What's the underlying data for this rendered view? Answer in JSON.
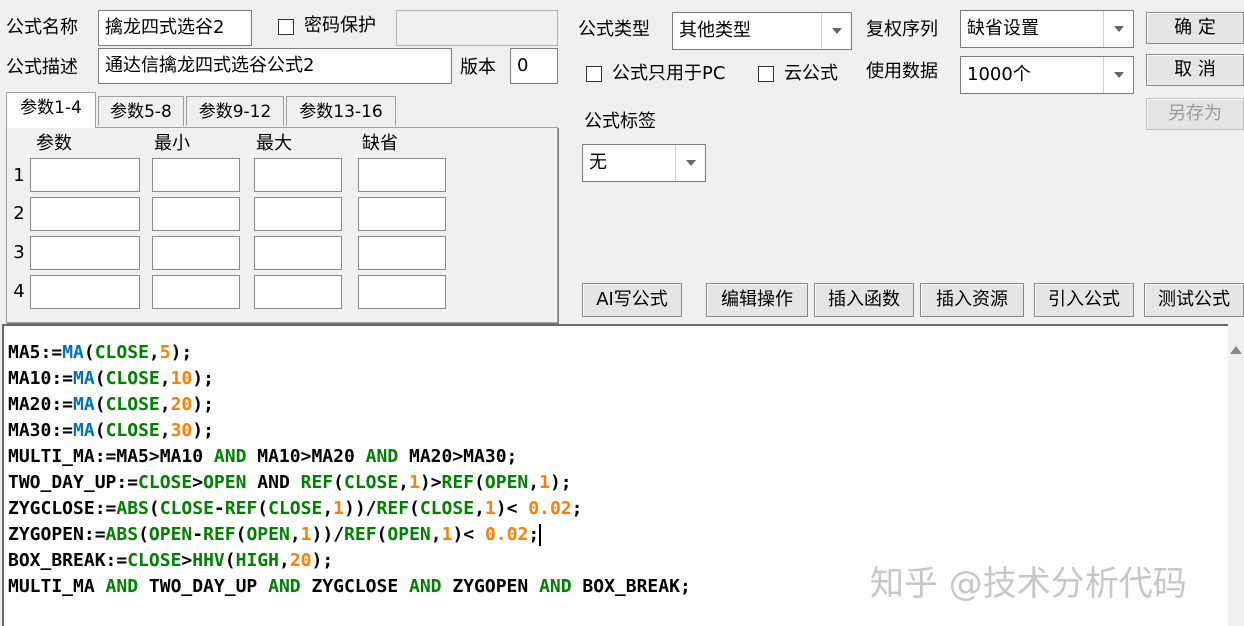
{
  "formula_name": {
    "label": "公式名称",
    "value": "擒龙四式选谷2"
  },
  "password": {
    "label": "密码保护",
    "value": ""
  },
  "formula_desc": {
    "label": "公式描述",
    "value": "通达信擒龙四式选谷公式2"
  },
  "version": {
    "label": "版本",
    "value": "0"
  },
  "formula_type": {
    "label": "公式类型",
    "value": "其他类型"
  },
  "rights_seq": {
    "label": "复权序列",
    "value": "缺省设置"
  },
  "pc_only": {
    "label": "公式只用于PC"
  },
  "cloud": {
    "label": "云公式"
  },
  "usage_data": {
    "label": "使用数据",
    "value": "1000个"
  },
  "formula_tag": {
    "label": "公式标签",
    "value": "无"
  },
  "buttons": {
    "ok": "确  定",
    "cancel": "取  消",
    "save_as": "另存为",
    "ai": "AI写公式",
    "edit": "编辑操作",
    "insert_func": "插入函数",
    "insert_res": "插入资源",
    "import": "引入公式",
    "test": "测试公式"
  },
  "tabs": [
    "参数1-4",
    "参数5-8",
    "参数9-12",
    "参数13-16"
  ],
  "param_headers": [
    "参数",
    "最小",
    "最大",
    "缺省"
  ],
  "param_rows": [
    "1",
    "2",
    "3",
    "4"
  ],
  "code_lines": [
    [
      [
        "k",
        "MA5:="
      ],
      [
        "fb",
        "MA"
      ],
      [
        "o",
        "("
      ],
      [
        "fg",
        "CLOSE"
      ],
      [
        "o",
        ","
      ],
      [
        "n",
        "5"
      ],
      [
        "o",
        ");"
      ]
    ],
    [
      [
        "k",
        "MA10:="
      ],
      [
        "fb",
        "MA"
      ],
      [
        "o",
        "("
      ],
      [
        "fg",
        "CLOSE"
      ],
      [
        "o",
        ","
      ],
      [
        "n",
        "10"
      ],
      [
        "o",
        ");"
      ]
    ],
    [
      [
        "k",
        "MA20:="
      ],
      [
        "fb",
        "MA"
      ],
      [
        "o",
        "("
      ],
      [
        "fg",
        "CLOSE"
      ],
      [
        "o",
        ","
      ],
      [
        "n",
        "20"
      ],
      [
        "o",
        ");"
      ]
    ],
    [
      [
        "k",
        "MA30:="
      ],
      [
        "fb",
        "MA"
      ],
      [
        "o",
        "("
      ],
      [
        "fg",
        "CLOSE"
      ],
      [
        "o",
        ","
      ],
      [
        "n",
        "30"
      ],
      [
        "o",
        ");"
      ]
    ],
    [
      [
        "k",
        "MULTI_MA:=MA5>MA10 "
      ],
      [
        "and",
        "AND"
      ],
      [
        "k",
        " MA10>MA20 "
      ],
      [
        "and",
        "AND"
      ],
      [
        "k",
        " MA20>MA30;"
      ]
    ],
    [
      [
        "k",
        "TWO_DAY_UP:="
      ],
      [
        "fg",
        "CLOSE"
      ],
      [
        "o",
        ">"
      ],
      [
        "fg",
        "OPEN"
      ],
      [
        "k",
        " AND "
      ],
      [
        "fg",
        "REF"
      ],
      [
        "o",
        "("
      ],
      [
        "fg",
        "CLOSE"
      ],
      [
        "o",
        ","
      ],
      [
        "n",
        "1"
      ],
      [
        "o",
        ")>"
      ],
      [
        "fg",
        "REF"
      ],
      [
        "o",
        "("
      ],
      [
        "fg",
        "OPEN"
      ],
      [
        "o",
        ","
      ],
      [
        "n",
        "1"
      ],
      [
        "o",
        ");"
      ]
    ],
    [
      [
        "k",
        "ZYGCLOSE:="
      ],
      [
        "fg",
        "ABS"
      ],
      [
        "o",
        "("
      ],
      [
        "fg",
        "CLOSE"
      ],
      [
        "o",
        "-"
      ],
      [
        "fg",
        "REF"
      ],
      [
        "o",
        "("
      ],
      [
        "fg",
        "CLOSE"
      ],
      [
        "o",
        ","
      ],
      [
        "n",
        "1"
      ],
      [
        "o",
        "))/"
      ],
      [
        "fg",
        "REF"
      ],
      [
        "o",
        "("
      ],
      [
        "fg",
        "CLOSE"
      ],
      [
        "o",
        ","
      ],
      [
        "n",
        "1"
      ],
      [
        "o",
        ")< "
      ],
      [
        "n",
        "0.02"
      ],
      [
        "o",
        ";"
      ]
    ],
    [
      [
        "k",
        "ZYGOPEN:="
      ],
      [
        "fg",
        "ABS"
      ],
      [
        "o",
        "("
      ],
      [
        "fg",
        "OPEN"
      ],
      [
        "o",
        "-"
      ],
      [
        "fg",
        "REF"
      ],
      [
        "o",
        "("
      ],
      [
        "fg",
        "OPEN"
      ],
      [
        "o",
        ","
      ],
      [
        "n",
        "1"
      ],
      [
        "o",
        "))/"
      ],
      [
        "fg",
        "REF"
      ],
      [
        "o",
        "("
      ],
      [
        "fg",
        "OPEN"
      ],
      [
        "o",
        ","
      ],
      [
        "n",
        "1"
      ],
      [
        "o",
        ")< "
      ],
      [
        "n",
        "0.02"
      ],
      [
        "o",
        ";"
      ],
      [
        "caret",
        ""
      ]
    ],
    [
      [
        "k",
        "BOX_BREAK:="
      ],
      [
        "fg",
        "CLOSE"
      ],
      [
        "o",
        ">"
      ],
      [
        "fg",
        "HHV"
      ],
      [
        "o",
        "("
      ],
      [
        "fg",
        "HIGH"
      ],
      [
        "o",
        ","
      ],
      [
        "n",
        "20"
      ],
      [
        "o",
        ");"
      ]
    ],
    [
      [
        "k",
        "MULTI_MA "
      ],
      [
        "and",
        "AND"
      ],
      [
        "k",
        " TWO_DAY_UP "
      ],
      [
        "and",
        "AND"
      ],
      [
        "k",
        " ZYGCLOSE "
      ],
      [
        "and",
        "AND"
      ],
      [
        "k",
        " ZYGOPEN "
      ],
      [
        "and",
        "AND"
      ],
      [
        "k",
        " BOX_BREAK;"
      ]
    ]
  ],
  "watermark": "知乎 @技术分析代码",
  "colors": {
    "keyword_blue": "#0070c0",
    "func_green": "#008000",
    "number_orange": "#ff8000"
  }
}
